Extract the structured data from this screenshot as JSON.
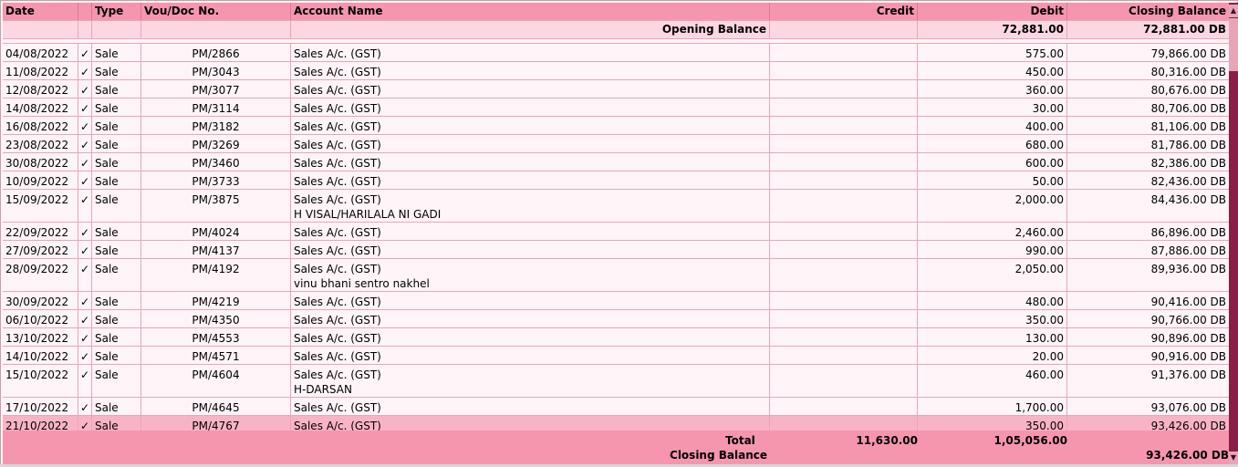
{
  "headers": {
    "date": "Date",
    "type": "Type",
    "vou": "Vou/Doc No.",
    "account": "Account Name",
    "credit": "Credit",
    "debit": "Debit",
    "closing": "Closing Balance"
  },
  "opening": {
    "label": "Opening Balance",
    "debit": "72,881.00",
    "closing": "72,881.00 DB"
  },
  "check_mark": "✓",
  "rows": [
    {
      "date": "04/08/2022",
      "type": "Sale",
      "vou": "PM/2866",
      "account": "Sales A/c. (GST)",
      "narration": "",
      "credit": "",
      "debit": "575.00",
      "closing": "79,866.00 DB"
    },
    {
      "date": "11/08/2022",
      "type": "Sale",
      "vou": "PM/3043",
      "account": "Sales A/c. (GST)",
      "narration": "",
      "credit": "",
      "debit": "450.00",
      "closing": "80,316.00 DB"
    },
    {
      "date": "12/08/2022",
      "type": "Sale",
      "vou": "PM/3077",
      "account": "Sales A/c. (GST)",
      "narration": "",
      "credit": "",
      "debit": "360.00",
      "closing": "80,676.00 DB"
    },
    {
      "date": "14/08/2022",
      "type": "Sale",
      "vou": "PM/3114",
      "account": "Sales A/c. (GST)",
      "narration": "",
      "credit": "",
      "debit": "30.00",
      "closing": "80,706.00 DB"
    },
    {
      "date": "16/08/2022",
      "type": "Sale",
      "vou": "PM/3182",
      "account": "Sales A/c. (GST)",
      "narration": "",
      "credit": "",
      "debit": "400.00",
      "closing": "81,106.00 DB"
    },
    {
      "date": "23/08/2022",
      "type": "Sale",
      "vou": "PM/3269",
      "account": "Sales A/c. (GST)",
      "narration": "",
      "credit": "",
      "debit": "680.00",
      "closing": "81,786.00 DB"
    },
    {
      "date": "30/08/2022",
      "type": "Sale",
      "vou": "PM/3460",
      "account": "Sales A/c. (GST)",
      "narration": "",
      "credit": "",
      "debit": "600.00",
      "closing": "82,386.00 DB"
    },
    {
      "date": "10/09/2022",
      "type": "Sale",
      "vou": "PM/3733",
      "account": "Sales A/c. (GST)",
      "narration": "",
      "credit": "",
      "debit": "50.00",
      "closing": "82,436.00 DB"
    },
    {
      "date": "15/09/2022",
      "type": "Sale",
      "vou": "PM/3875",
      "account": "Sales A/c. (GST)",
      "narration": "H VISAL/HARILALA NI GADI",
      "credit": "",
      "debit": "2,000.00",
      "closing": "84,436.00 DB"
    },
    {
      "date": "22/09/2022",
      "type": "Sale",
      "vou": "PM/4024",
      "account": "Sales A/c. (GST)",
      "narration": "",
      "credit": "",
      "debit": "2,460.00",
      "closing": "86,896.00 DB"
    },
    {
      "date": "27/09/2022",
      "type": "Sale",
      "vou": "PM/4137",
      "account": "Sales A/c. (GST)",
      "narration": "",
      "credit": "",
      "debit": "990.00",
      "closing": "87,886.00 DB"
    },
    {
      "date": "28/09/2022",
      "type": "Sale",
      "vou": "PM/4192",
      "account": "Sales A/c. (GST)",
      "narration": "vinu bhani sentro nakhel",
      "credit": "",
      "debit": "2,050.00",
      "closing": "89,936.00 DB"
    },
    {
      "date": "30/09/2022",
      "type": "Sale",
      "vou": "PM/4219",
      "account": "Sales A/c. (GST)",
      "narration": "",
      "credit": "",
      "debit": "480.00",
      "closing": "90,416.00 DB"
    },
    {
      "date": "06/10/2022",
      "type": "Sale",
      "vou": "PM/4350",
      "account": "Sales A/c. (GST)",
      "narration": "",
      "credit": "",
      "debit": "350.00",
      "closing": "90,766.00 DB"
    },
    {
      "date": "13/10/2022",
      "type": "Sale",
      "vou": "PM/4553",
      "account": "Sales A/c. (GST)",
      "narration": "",
      "credit": "",
      "debit": "130.00",
      "closing": "90,896.00 DB"
    },
    {
      "date": "14/10/2022",
      "type": "Sale",
      "vou": "PM/4571",
      "account": "Sales A/c. (GST)",
      "narration": "",
      "credit": "",
      "debit": "20.00",
      "closing": "90,916.00 DB"
    },
    {
      "date": "15/10/2022",
      "type": "Sale",
      "vou": "PM/4604",
      "account": "Sales A/c. (GST)",
      "narration": "H-DARSAN",
      "credit": "",
      "debit": "460.00",
      "closing": "91,376.00 DB"
    },
    {
      "date": "17/10/2022",
      "type": "Sale",
      "vou": "PM/4645",
      "account": "Sales A/c. (GST)",
      "narration": "",
      "credit": "",
      "debit": "1,700.00",
      "closing": "93,076.00 DB"
    },
    {
      "date": "21/10/2022",
      "type": "Sale",
      "vou": "PM/4767",
      "account": "Sales A/c. (GST)",
      "narration": "",
      "credit": "",
      "debit": "350.00",
      "closing": "93,426.00 DB"
    }
  ],
  "footer": {
    "total_label": "Total",
    "total_credit": "11,630.00",
    "total_debit": "1,05,056.00",
    "closing_label": "Closing Balance",
    "closing_value": "93,426.00 DB"
  },
  "scrollbar": {
    "up_icon": "triangle-up-icon",
    "down_icon": "triangle-down-icon"
  },
  "colors": {
    "header": "#f696ae",
    "opening": "#fbd7e2",
    "row": "#fff4f8",
    "selected": "#f8b4c6",
    "scroll_track": "#8b1e46"
  }
}
